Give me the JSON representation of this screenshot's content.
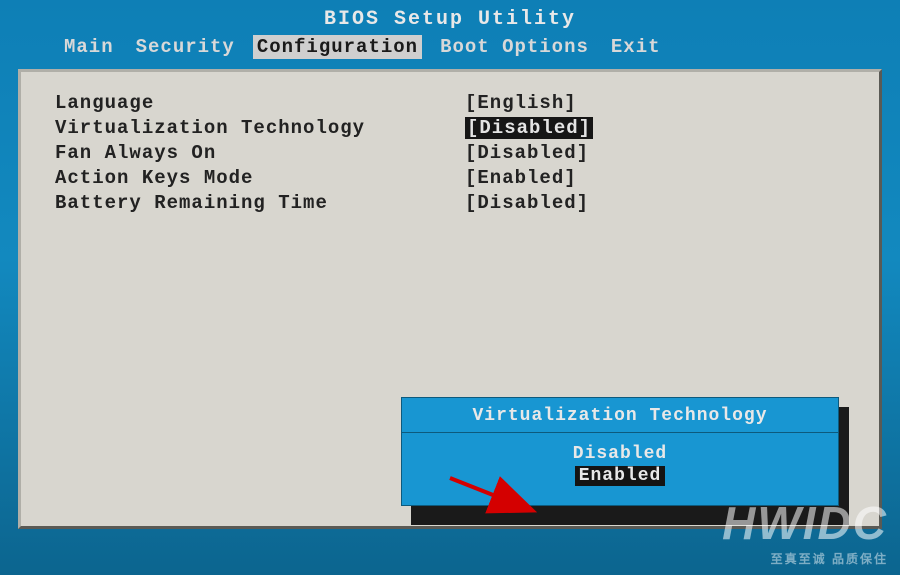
{
  "title": "BIOS Setup Utility",
  "menubar": {
    "items": [
      "Main",
      "Security",
      "Configuration",
      "Boot Options",
      "Exit"
    ],
    "active_index": 2
  },
  "settings": [
    {
      "label": "Language",
      "value": "[English]",
      "selected": false
    },
    {
      "label": "Virtualization Technology",
      "value": "[Disabled]",
      "selected": true
    },
    {
      "label": "Fan Always On",
      "value": "[Disabled]",
      "selected": false
    },
    {
      "label": "Action Keys Mode",
      "value": "[Enabled]",
      "selected": false
    },
    {
      "label": "Battery Remaining Time",
      "value": "[Disabled]",
      "selected": false
    }
  ],
  "popup": {
    "title": "Virtualization Technology",
    "options": [
      "Disabled",
      "Enabled"
    ],
    "selected_index": 1
  },
  "watermark": {
    "brand": "HWIDC",
    "tagline": "至真至诚 品质保住"
  }
}
